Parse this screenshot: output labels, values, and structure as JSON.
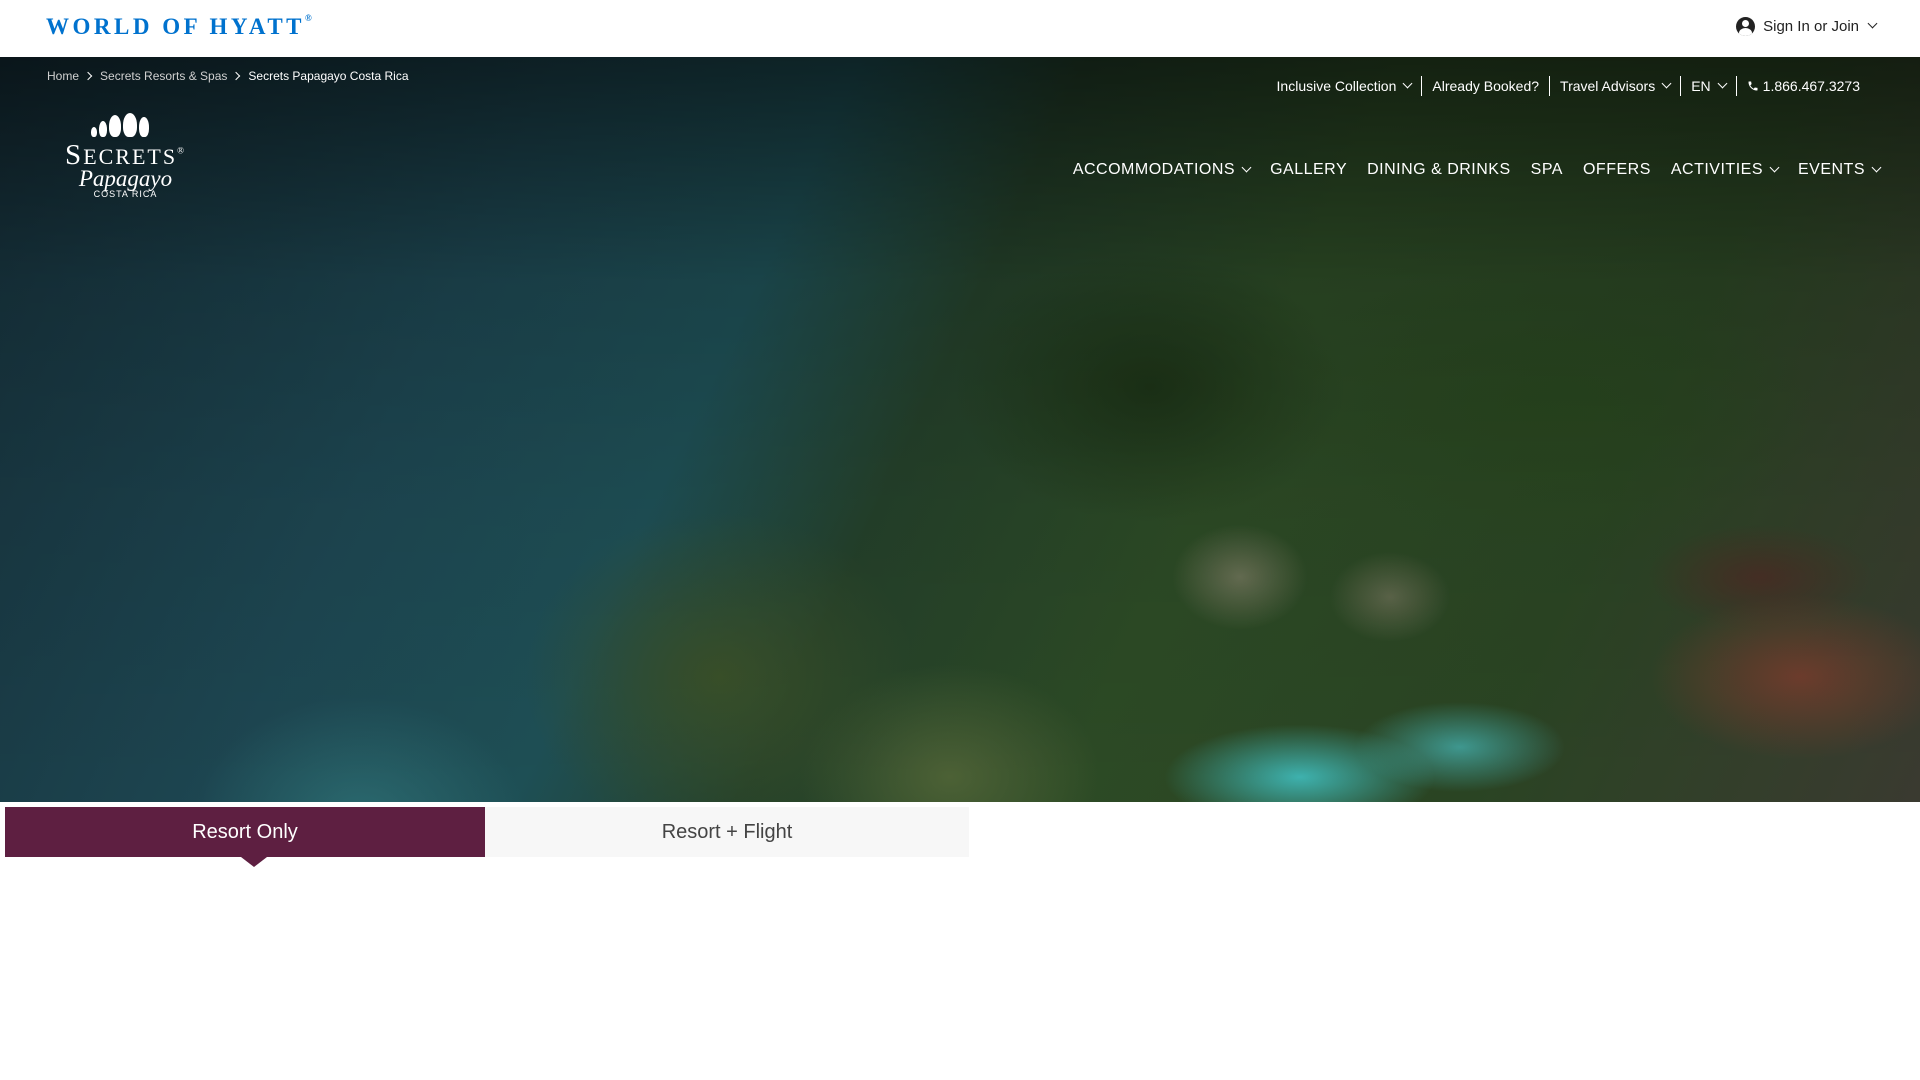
{
  "header": {
    "brand": "WORLD OF HYATT",
    "brand_mark": "®",
    "signin_label": "Sign In or Join"
  },
  "breadcrumb": [
    "Home",
    "Secrets Resorts & Spas",
    "Secrets Papagayo Costa Rica"
  ],
  "utility_nav": {
    "collection": "Inclusive Collection",
    "booked": "Already Booked?",
    "advisors": "Travel Advisors",
    "language": "EN",
    "phone": "1.866.467.3273"
  },
  "logo": {
    "wordmark_first": "S",
    "wordmark_rest": "ECRETS",
    "wordmark_mark": "®",
    "script": "Papagayo",
    "location": "COSTA RICA"
  },
  "main_nav": [
    "ACCOMMODATIONS",
    "GALLERY",
    "DINING & DRINKS",
    "SPA",
    "OFFERS",
    "ACTIVITIES",
    "EVENTS"
  ],
  "booking_tabs": {
    "resort_only": "Resort Only",
    "resort_flight": "Resort + Flight"
  },
  "colors": {
    "brand_blue": "#0072ce",
    "tab_active": "#5e1f41",
    "tab_inactive": "#f7f7f7"
  }
}
